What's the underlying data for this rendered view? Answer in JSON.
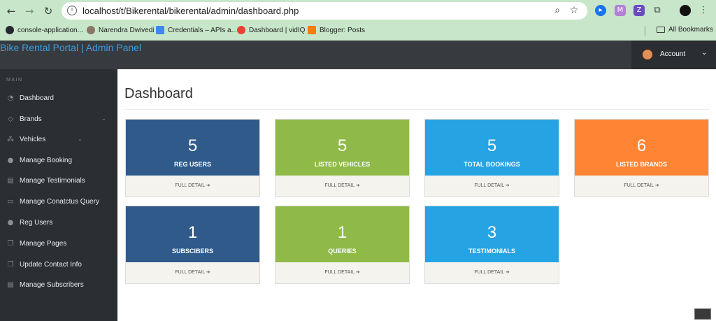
{
  "browser": {
    "url": "localhost/t/Bikerental/bikerental/admin/dashboard.php",
    "bookmarks": [
      {
        "label": "console-application...",
        "icon": "github-icon"
      },
      {
        "label": "Narendra Dwivedi",
        "icon": "profile-icon"
      },
      {
        "label": "Credentials – APIs a...",
        "icon": "api-icon"
      },
      {
        "label": "Dashboard | vidIQ",
        "icon": "google-icon"
      },
      {
        "label": "Blogger: Posts",
        "icon": "blogger-icon"
      }
    ],
    "all_bookmarks": "All Bookmarks"
  },
  "header": {
    "title": "Bike Rental Portal | Admin Panel",
    "account_label": "Account"
  },
  "sidebar": {
    "section": "MAIN",
    "items": [
      {
        "label": "Dashboard",
        "icon": "dashboard-icon"
      },
      {
        "label": "Brands",
        "icon": "brands-icon",
        "has_submenu": true
      },
      {
        "label": "Vehicles",
        "icon": "vehicles-icon",
        "has_submenu": true
      },
      {
        "label": "Manage Booking",
        "icon": "users-icon"
      },
      {
        "label": "Manage Testimonials",
        "icon": "table-icon"
      },
      {
        "label": "Manage Conatctus Query",
        "icon": "desktop-icon"
      },
      {
        "label": "Reg Users",
        "icon": "users-icon"
      },
      {
        "label": "Manage Pages",
        "icon": "files-icon"
      },
      {
        "label": "Update Contact Info",
        "icon": "files-icon"
      },
      {
        "label": "Manage Subscribers",
        "icon": "table-icon"
      }
    ]
  },
  "main": {
    "title": "Dashboard",
    "link_label": "FULL DETAIL",
    "cards": [
      {
        "value": "5",
        "label": "REG USERS",
        "color": "#2f5a8a"
      },
      {
        "value": "5",
        "label": "LISTED VEHICLES",
        "color": "#8fba48"
      },
      {
        "value": "5",
        "label": "TOTAL BOOKINGS",
        "color": "#25a3e3"
      },
      {
        "value": "6",
        "label": "LISTED BRANDS",
        "color": "#ff8534"
      },
      {
        "value": "1",
        "label": "SUBSCIBERS",
        "color": "#2f5a8a"
      },
      {
        "value": "1",
        "label": "QUERIES",
        "color": "#8fba48"
      },
      {
        "value": "3",
        "label": "TESTIMONIALS",
        "color": "#25a3e3"
      }
    ]
  }
}
